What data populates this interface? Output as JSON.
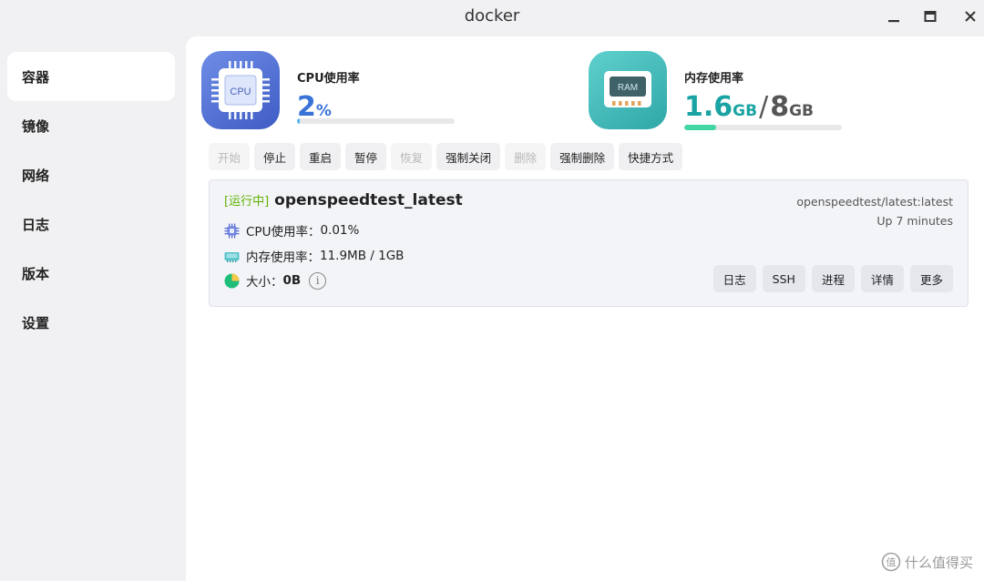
{
  "window": {
    "title": "docker"
  },
  "sidebar": {
    "items": [
      {
        "label": "容器",
        "active": true
      },
      {
        "label": "镜像"
      },
      {
        "label": "网络"
      },
      {
        "label": "日志"
      },
      {
        "label": "版本"
      },
      {
        "label": "设置"
      }
    ]
  },
  "stats": {
    "cpu": {
      "icon": "cpu-chip-icon",
      "icon_text": "CPU",
      "label": "CPU使用率",
      "value": "2",
      "unit": "%",
      "usage_fraction": 0.02,
      "color": "#3a73d8",
      "accent": "#4fb6ec"
    },
    "ram": {
      "icon": "ram-module-icon",
      "icon_text": "RAM",
      "label": "内存使用率",
      "used": "1.6",
      "used_unit": "GB",
      "separator": "/",
      "total": "8",
      "total_unit": "GB",
      "usage_fraction": 0.2,
      "color": "#1aa3a3",
      "total_color": "#555555",
      "accent": "#42d6a4"
    }
  },
  "toolbar": {
    "buttons": [
      {
        "label": "开始",
        "enabled": false
      },
      {
        "label": "停止",
        "enabled": true
      },
      {
        "label": "重启",
        "enabled": true
      },
      {
        "label": "暂停",
        "enabled": true
      },
      {
        "label": "恢复",
        "enabled": false
      },
      {
        "label": "强制关闭",
        "enabled": true
      },
      {
        "label": "删除",
        "enabled": false
      },
      {
        "label": "强制删除",
        "enabled": true
      },
      {
        "label": "快捷方式",
        "enabled": true
      }
    ]
  },
  "container": {
    "status": "[运行中]",
    "status_color": "#5fb200",
    "name": "openspeedtest_latest",
    "image": "openspeedtest/latest:latest",
    "uptime": "Up 7 minutes",
    "cpu": {
      "icon": "cpu-small-icon",
      "label": "CPU使用率：",
      "value": "0.01%"
    },
    "memory": {
      "icon": "memory-small-icon",
      "label": "内存使用率：",
      "value": "11.9MB / 1GB"
    },
    "size": {
      "icon": "pie-chart-icon",
      "label": "大小：",
      "value": "0B",
      "info_icon": "info-circle-icon",
      "info_symbol": "i"
    },
    "actions": [
      "日志",
      "SSH",
      "进程",
      "详情",
      "更多"
    ]
  },
  "watermark": {
    "text": "什么值得买",
    "icon": "zhi-logo-icon",
    "logo_text": "值"
  }
}
